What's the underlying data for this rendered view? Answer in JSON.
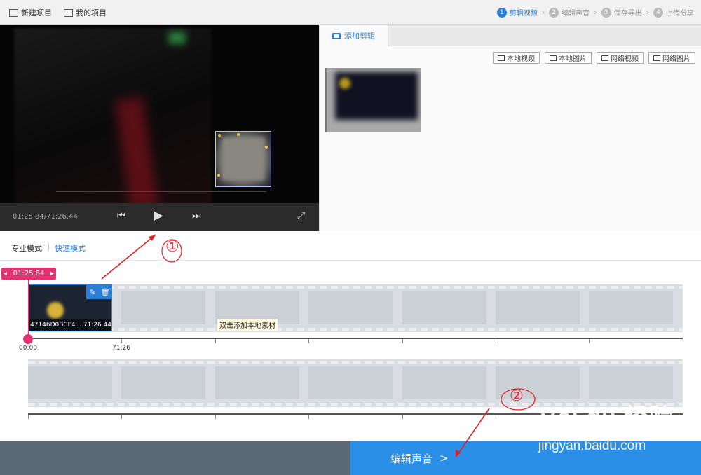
{
  "toolbar": {
    "new_project": "新建项目",
    "my_projects": "我的项目",
    "steps": [
      {
        "num": "1",
        "label": "剪辑视频"
      },
      {
        "num": "2",
        "label": "编辑声音"
      },
      {
        "num": "3",
        "label": "保存导出"
      },
      {
        "num": "4",
        "label": "上传分享"
      }
    ],
    "active_color": "#2a7fd6"
  },
  "player": {
    "time": "01:25.84/71:26.44"
  },
  "library": {
    "tab": "添加剪辑",
    "sources": [
      "本地视频",
      "本地图片",
      "网络视频",
      "网络图片"
    ]
  },
  "modes": {
    "pro": "专业模式",
    "fast": "快速模式"
  },
  "timeline": {
    "playhead": "01:25.84",
    "clip_name": "47146D0BCF4...",
    "clip_duration": "71:26.44",
    "tooltip": "双击添加本地素材",
    "ruler_start": "00:00",
    "ruler_mark": "71:26",
    "playhead_color": "#e0336f"
  },
  "footer": {
    "next_label": "编辑声音",
    "next_chevron": ">"
  },
  "annotations": {
    "one": "①",
    "two": "②"
  },
  "watermark": {
    "logo": "Bai du 经验",
    "url": "jingyan.baidu.com"
  }
}
